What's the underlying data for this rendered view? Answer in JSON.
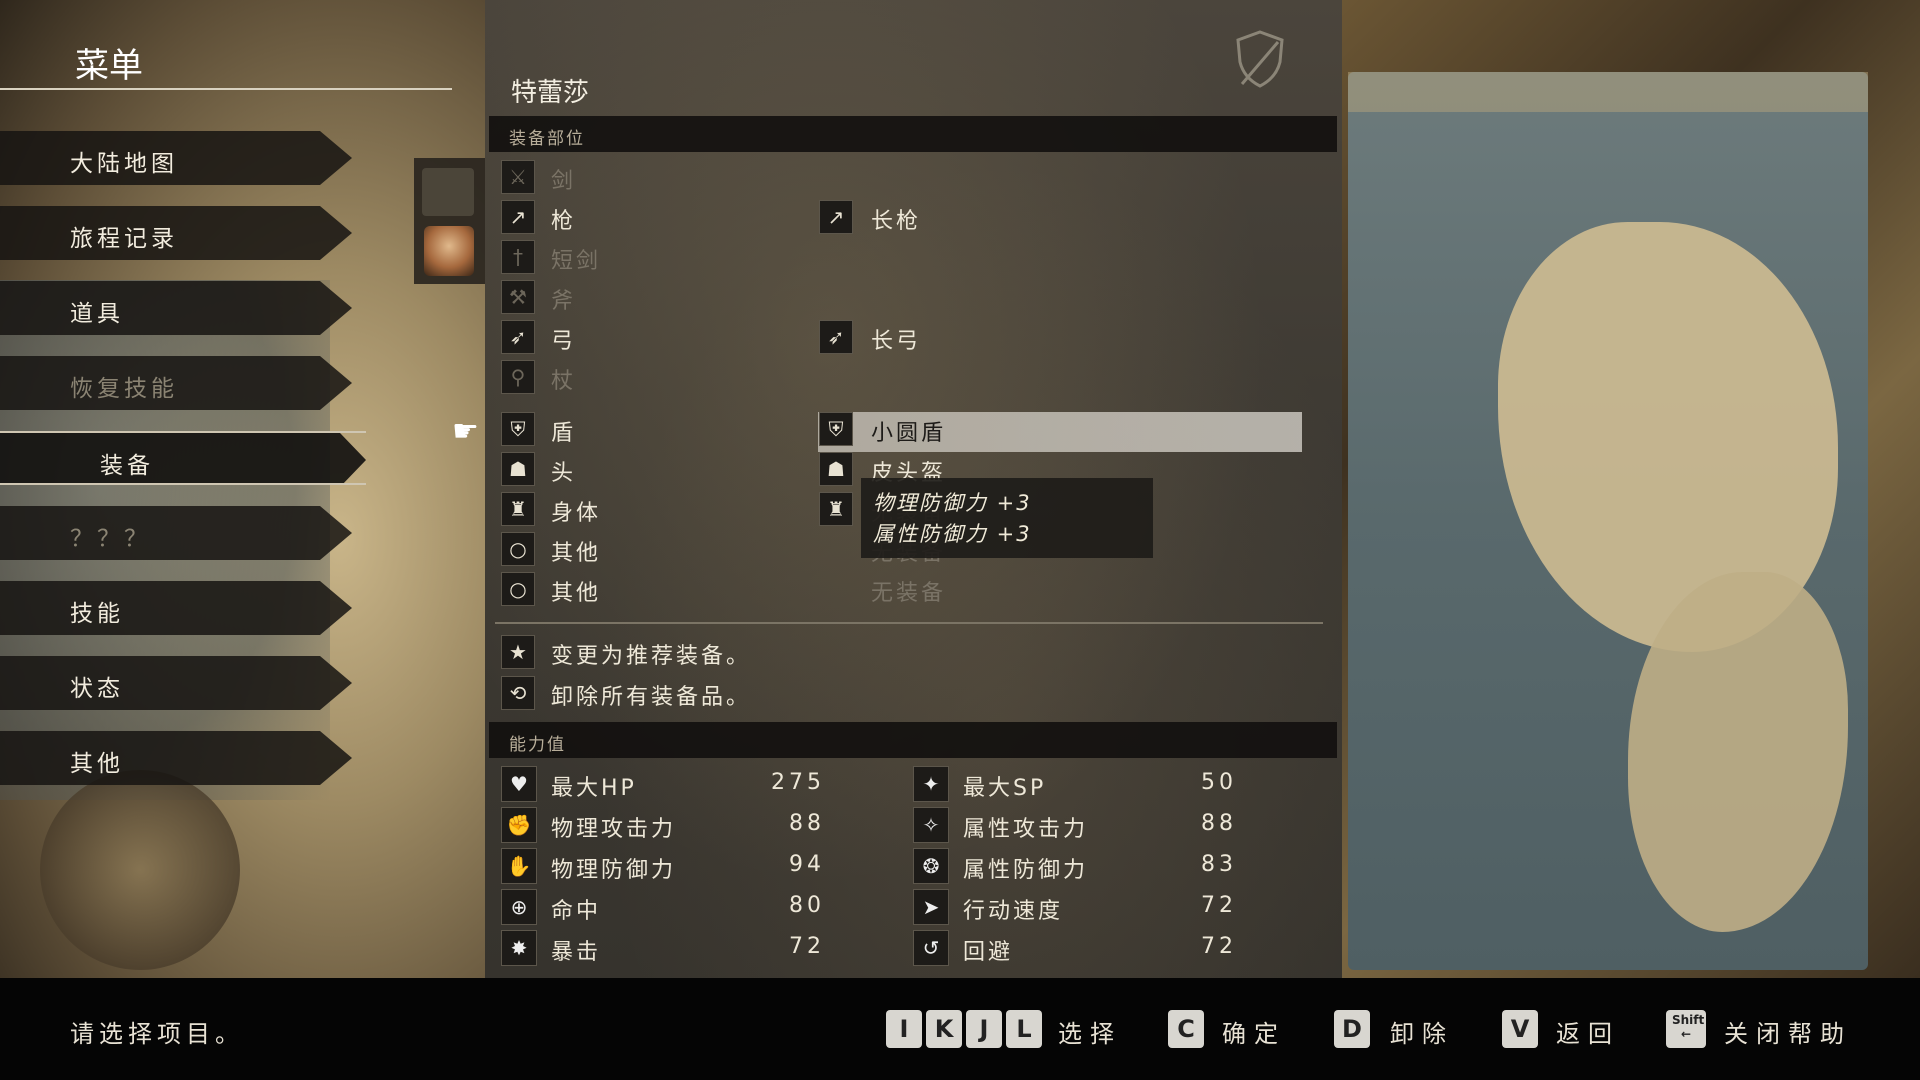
{
  "menu": {
    "title": "菜单",
    "items": [
      {
        "label": "大陆地图"
      },
      {
        "label": "旅程记录"
      },
      {
        "label": "道具"
      },
      {
        "label": "恢复技能"
      },
      {
        "label": "装备"
      },
      {
        "label": "？？？"
      },
      {
        "label": "技能"
      },
      {
        "label": "状态"
      },
      {
        "label": "其他"
      }
    ],
    "active_index": 4
  },
  "character": {
    "name": "特蕾莎"
  },
  "equipment": {
    "section_title": "装备部位",
    "slots": [
      {
        "label": "剑",
        "icon": "sword-icon",
        "enabled": false,
        "item": ""
      },
      {
        "label": "枪",
        "icon": "spear-icon",
        "enabled": true,
        "item": "长枪"
      },
      {
        "label": "短剑",
        "icon": "dagger-icon",
        "enabled": false,
        "item": ""
      },
      {
        "label": "斧",
        "icon": "axe-icon",
        "enabled": false,
        "item": ""
      },
      {
        "label": "弓",
        "icon": "bow-icon",
        "enabled": true,
        "item": "长弓"
      },
      {
        "label": "杖",
        "icon": "staff-icon",
        "enabled": false,
        "item": ""
      },
      {
        "label": "盾",
        "icon": "shield-icon",
        "enabled": true,
        "item": "小圆盾"
      },
      {
        "label": "头",
        "icon": "helmet-icon",
        "enabled": true,
        "item": "皮头盔"
      },
      {
        "label": "身体",
        "icon": "armor-icon",
        "enabled": true,
        "item": "无装备"
      },
      {
        "label": "其他",
        "icon": "accessory-icon",
        "enabled": true,
        "item": "无装备"
      },
      {
        "label": "其他",
        "icon": "accessory-icon",
        "enabled": true,
        "item": "无装备"
      }
    ],
    "selected_index": 6,
    "tooltip": [
      "物理防御力 +3",
      "属性防御力 +3"
    ],
    "actions": [
      {
        "label": "变更为推荐装备。",
        "icon": "star-icon"
      },
      {
        "label": "卸除所有装备品。",
        "icon": "unequip-icon"
      }
    ]
  },
  "stats": {
    "section_title": "能力值",
    "left": [
      {
        "label": "最大HP",
        "value": "275",
        "icon": "heart-icon"
      },
      {
        "label": "物理攻击力",
        "value": "88",
        "icon": "phys-attack-icon"
      },
      {
        "label": "物理防御力",
        "value": "94",
        "icon": "phys-defense-icon"
      },
      {
        "label": "命中",
        "value": "80",
        "icon": "accuracy-icon"
      },
      {
        "label": "暴击",
        "value": "72",
        "icon": "critical-icon"
      }
    ],
    "right": [
      {
        "label": "最大SP",
        "value": "50",
        "icon": "sp-icon"
      },
      {
        "label": "属性攻击力",
        "value": "88",
        "icon": "elem-attack-icon"
      },
      {
        "label": "属性防御力",
        "value": "83",
        "icon": "elem-defense-icon"
      },
      {
        "label": "行动速度",
        "value": "72",
        "icon": "speed-icon"
      },
      {
        "label": "回避",
        "value": "72",
        "icon": "evasion-icon"
      }
    ]
  },
  "help_bar": {
    "prompt": "请选择项目。",
    "keys": [
      {
        "keys": [
          "I",
          "K",
          "J",
          "L"
        ],
        "action": "选择"
      },
      {
        "keys": [
          "C"
        ],
        "action": "确定"
      },
      {
        "keys": [
          "D"
        ],
        "action": "卸除"
      },
      {
        "keys": [
          "V"
        ],
        "action": "返回"
      },
      {
        "keys": [
          "Shift"
        ],
        "action": "关闭帮助"
      }
    ]
  },
  "colors": {
    "highlight": "#c8c4bb",
    "panel": "#3f3b34",
    "bar": "#050505"
  }
}
